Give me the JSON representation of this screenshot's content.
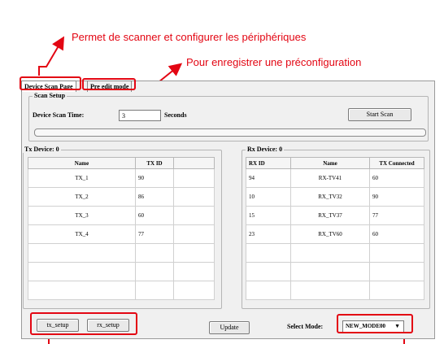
{
  "annotations": {
    "top": "Permet de scanner et configurer les périphériques",
    "middle": "Pour enregistrer une préconfiguration"
  },
  "tabs": [
    "Device Scan Page",
    "Pre edit mode"
  ],
  "scan_setup": {
    "group_label": "Scan Setup",
    "time_label": "Device Scan Time:",
    "time_value": "3",
    "unit": "Seconds",
    "start_button": "Start Scan",
    "progress": 0
  },
  "tx": {
    "group_label": "Tx Device: 0",
    "headers": [
      "Name",
      "TX ID"
    ],
    "rows": [
      [
        "TX_1",
        "90"
      ],
      [
        "TX_2",
        "86"
      ],
      [
        "TX_3",
        "60"
      ],
      [
        "TX_4",
        "77"
      ]
    ]
  },
  "rx": {
    "group_label": "Rx Device: 0",
    "headers": [
      "RX ID",
      "Name",
      "TX Connected"
    ],
    "rows": [
      [
        "94",
        "RX-TV41",
        "60"
      ],
      [
        "10",
        "RX_TV32",
        "90"
      ],
      [
        "15",
        "RX_TV37",
        "77"
      ],
      [
        "23",
        "RX_TV60",
        "60"
      ]
    ]
  },
  "bottom": {
    "tx_setup": "tx_setup",
    "rx_setup": "rx_setup",
    "update": "Update",
    "select_mode_label": "Select Mode:",
    "select_mode_value": "NEW_MODE00"
  },
  "colors": {
    "annotation": "#e30613"
  }
}
